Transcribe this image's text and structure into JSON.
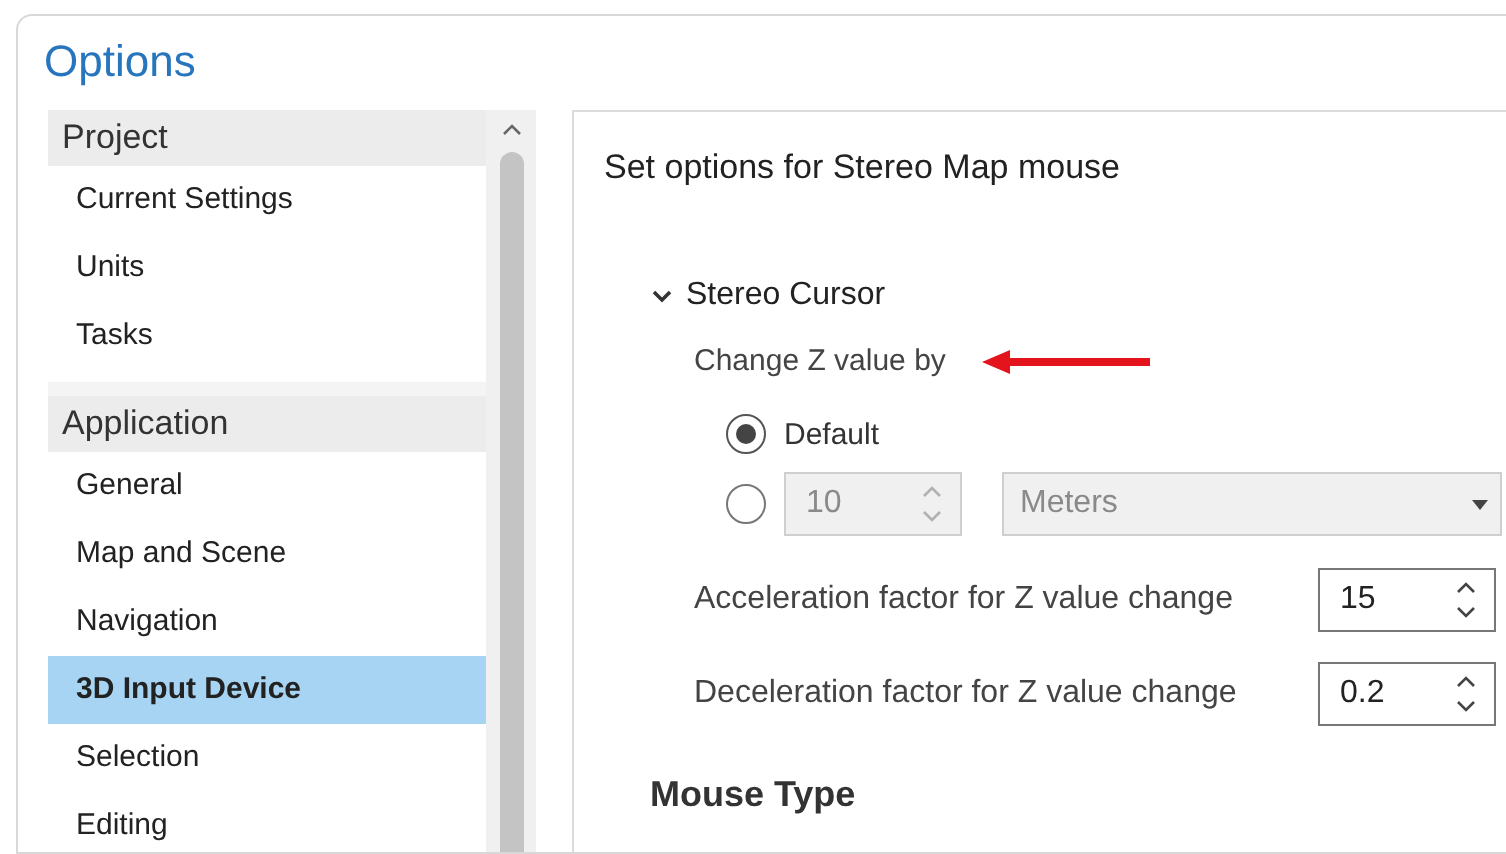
{
  "window": {
    "title": "Options"
  },
  "sidebar": {
    "groups": [
      {
        "label": "Project",
        "items": [
          {
            "label": "Current Settings",
            "selected": false
          },
          {
            "label": "Units",
            "selected": false
          },
          {
            "label": "Tasks",
            "selected": false
          }
        ]
      },
      {
        "label": "Application",
        "items": [
          {
            "label": "General",
            "selected": false
          },
          {
            "label": "Map and Scene",
            "selected": false
          },
          {
            "label": "Navigation",
            "selected": false
          },
          {
            "label": "3D Input Device",
            "selected": true
          },
          {
            "label": "Selection",
            "selected": false
          },
          {
            "label": "Editing",
            "selected": false
          }
        ]
      }
    ]
  },
  "panel": {
    "heading": "Set options for Stereo Map mouse",
    "section": {
      "title": "Stereo Cursor",
      "expanded": true,
      "subtitle": "Change Z value by",
      "options": [
        {
          "kind": "label",
          "label": "Default",
          "selected": true
        },
        {
          "kind": "amount",
          "value": "10",
          "unit": "Meters",
          "selected": false,
          "disabled": true
        }
      ],
      "fields": [
        {
          "label": "Acceleration factor for Z value change",
          "value": "15"
        },
        {
          "label": "Deceleration factor for Z value change",
          "value": "0.2"
        }
      ]
    },
    "next_heading": "Mouse Type"
  }
}
